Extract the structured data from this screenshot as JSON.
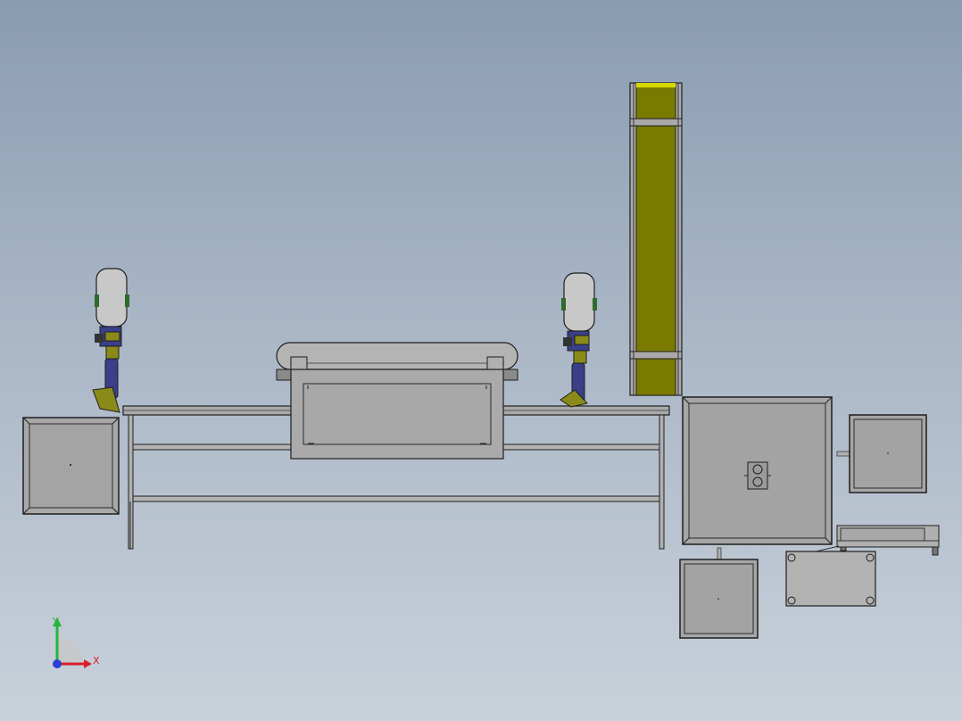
{
  "viewport": {
    "background_top": "#8a9cb2",
    "background_bottom": "#c9d1da"
  },
  "triad": {
    "x_label": "X",
    "y_label": "Y",
    "x_color": "#d9202a",
    "y_color": "#1fb83a",
    "z_color": "#2a3fd6"
  },
  "colors": {
    "frame_fill": "#a8a8a8",
    "frame_stroke": "#1e1e1e",
    "belt_yellow": "#7a7a00",
    "belt_highlight": "#d8d800",
    "robot_body": "#c8c8c8",
    "robot_blue": "#3a3f8a",
    "robot_yellow": "#8a8a1a",
    "robot_green": "#2f6a2f"
  },
  "components": [
    "left-station-frame",
    "assembly-table",
    "center-conveyor-box",
    "left-robot-arm",
    "right-robot-arm",
    "vertical-belt-conveyor",
    "right-main-cabinet",
    "right-small-frame",
    "bottom-small-frame",
    "base-plate",
    "electronic-scale"
  ]
}
